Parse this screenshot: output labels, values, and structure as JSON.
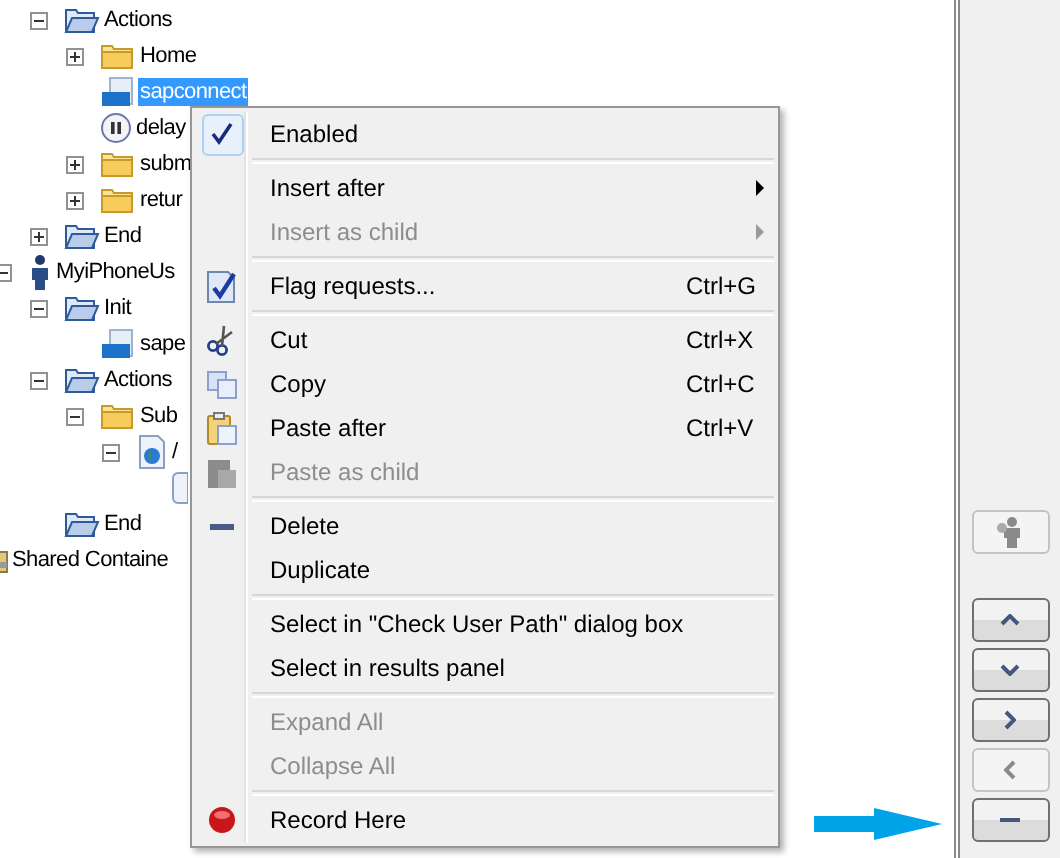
{
  "tree": [
    {
      "children": [
        {
          "label": "Actions",
          "kind": "folder-blue",
          "expanded": true,
          "children": [
            {
              "label": "Home",
              "kind": "folder-yellow",
              "expanded": false
            },
            {
              "label": "sapconnect",
              "kind": "sap",
              "selected": true
            },
            {
              "label": "delay",
              "kind": "pause",
              "selected": false
            },
            {
              "label": "subm",
              "kind": "folder-yellow",
              "expanded": false
            },
            {
              "label": "retur",
              "kind": "folder-yellow",
              "expanded": false
            }
          ]
        },
        {
          "label": "End",
          "kind": "folder-blue",
          "expanded": false
        }
      ]
    },
    {
      "label": "MyiPhoneUs",
      "kind": "user",
      "expanded": true,
      "children": [
        {
          "label": "Init",
          "kind": "folder-blue",
          "expanded": true,
          "children": [
            {
              "label": "sape",
              "kind": "sap",
              "selected": false
            }
          ]
        },
        {
          "label": "Actions",
          "kind": "folder-blue",
          "expanded": true,
          "children": [
            {
              "label": "Sub",
              "kind": "folder-yellow",
              "expanded": true,
              "children": [
                {
                  "label": "/",
                  "kind": "page",
                  "expanded": true,
                  "children": [
                    {
                      "kind": "request"
                    }
                  ]
                }
              ]
            }
          ]
        },
        {
          "label": "End",
          "kind": "folder-blue"
        }
      ]
    },
    {
      "label": "Shared Containe",
      "kind": "container"
    }
  ],
  "context_menu": [
    {
      "kind": "plain",
      "label": "Enabled",
      "checked": true
    },
    {
      "kind": "separator"
    },
    {
      "kind": "plain",
      "label": "Insert after",
      "submenu": true,
      "disabled": false
    },
    {
      "kind": "plain",
      "label": "Insert as child",
      "submenu": true,
      "disabled": true
    },
    {
      "kind": "separator"
    },
    {
      "kind": "flag",
      "label": "Flag requests...",
      "shortcut": "Ctrl+G"
    },
    {
      "kind": "separator"
    },
    {
      "kind": "cut",
      "label": "Cut",
      "shortcut": "Ctrl+X"
    },
    {
      "kind": "copy",
      "label": "Copy",
      "shortcut": "Ctrl+C"
    },
    {
      "kind": "paste",
      "label": "Paste after",
      "shortcut": "Ctrl+V"
    },
    {
      "kind": "paste",
      "label": "Paste as child",
      "disabled": true
    },
    {
      "kind": "separator"
    },
    {
      "kind": "delete",
      "label": "Delete"
    },
    {
      "kind": "plain",
      "label": "Duplicate"
    },
    {
      "kind": "separator"
    },
    {
      "kind": "plain",
      "label": "Select in \"Check User Path\" dialog box"
    },
    {
      "kind": "plain",
      "label": "Select in results panel"
    },
    {
      "kind": "separator"
    },
    {
      "kind": "plain",
      "label": "Expand All",
      "disabled": true
    },
    {
      "kind": "plain",
      "label": "Collapse All",
      "disabled": true
    },
    {
      "kind": "separator"
    },
    {
      "kind": "record",
      "label": "Record Here"
    }
  ],
  "side_buttons": [
    {
      "kind": "user",
      "disabled": true
    },
    {
      "kind": "up",
      "disabled": false
    },
    {
      "kind": "down",
      "disabled": false
    },
    {
      "kind": "right",
      "disabled": false
    },
    {
      "kind": "left",
      "disabled": true
    },
    {
      "kind": "minus",
      "disabled": false
    }
  ]
}
